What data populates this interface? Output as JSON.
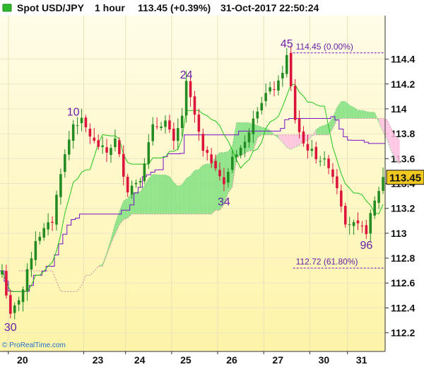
{
  "header": {
    "instrument": "Spot USD/JPY",
    "timeframe": "1 hour",
    "price": "113.45",
    "change": "(+0.39%)",
    "datetime": "31-Oct-2017 22:50:24"
  },
  "copyright": "© ProRealTime.com",
  "colors": {
    "background_top": "#fffce8",
    "background_bottom": "#fdf4a8",
    "bull_candle": "#228b22",
    "bear_candle": "#dc143c",
    "tenkan_sen": "#22c41c",
    "kijun_sen": "#7a10c8",
    "cloud_bearish": "#ffc0e0",
    "cloud_bullish": "#80e080",
    "wave_label": "#6a1fa8",
    "current_price_box": "#f0c820",
    "icon_green": "#2eb82e"
  },
  "icons": [
    "chart-panel-icon"
  ],
  "chart_data": {
    "type": "candlestick",
    "title": "Spot USD/JPY",
    "timeframe": "1 hour",
    "ylim": [
      112.05,
      114.75
    ],
    "y_ticks": [
      "112.2",
      "112.4",
      "112.6",
      "112.8",
      "113",
      "113.2",
      "113.4",
      "113.6",
      "113.8",
      "114",
      "114.2",
      "114.4"
    ],
    "x_ticks": [
      {
        "label": "20",
        "bar": 2
      },
      {
        "label": "23",
        "bar": 20
      },
      {
        "label": "24",
        "bar": 30
      },
      {
        "label": "25",
        "bar": 41
      },
      {
        "label": "26",
        "bar": 52
      },
      {
        "label": "27",
        "bar": 63
      },
      {
        "label": "30",
        "bar": 74
      },
      {
        "label": "31",
        "bar": 83
      }
    ],
    "current_price": "113.45",
    "grid": true,
    "level_lines": [
      {
        "label": "114.45 (0.00%)",
        "value": 114.45,
        "start_bar": 70
      },
      {
        "label": "112.72 (61.80%)",
        "value": 112.72,
        "start_bar": 70
      }
    ],
    "wave_labels": [
      {
        "text": "30",
        "bar": 2,
        "value": 112.34,
        "position": "below"
      },
      {
        "text": "10",
        "bar": 17,
        "value": 113.9,
        "position": "above"
      },
      {
        "text": "24",
        "bar": 44,
        "value": 114.2,
        "position": "above"
      },
      {
        "text": "34",
        "bar": 53,
        "value": 113.35,
        "position": "below"
      },
      {
        "text": "45",
        "bar": 68,
        "value": 114.45,
        "position": "above"
      },
      {
        "text": "96",
        "bar": 87,
        "value": 113.0,
        "position": "below"
      }
    ],
    "keypoints": [
      {
        "bar": 0,
        "value": 112.7
      },
      {
        "bar": 2,
        "value": 112.33
      },
      {
        "bar": 5,
        "value": 112.55
      },
      {
        "bar": 8,
        "value": 112.95
      },
      {
        "bar": 12,
        "value": 113.1
      },
      {
        "bar": 14,
        "value": 113.5
      },
      {
        "bar": 17,
        "value": 113.88
      },
      {
        "bar": 19,
        "value": 113.9
      },
      {
        "bar": 22,
        "value": 113.73
      },
      {
        "bar": 25,
        "value": 113.65
      },
      {
        "bar": 27,
        "value": 113.75
      },
      {
        "bar": 30,
        "value": 113.35
      },
      {
        "bar": 33,
        "value": 113.45
      },
      {
        "bar": 36,
        "value": 113.85
      },
      {
        "bar": 39,
        "value": 113.9
      },
      {
        "bar": 41,
        "value": 113.72
      },
      {
        "bar": 43,
        "value": 113.95
      },
      {
        "bar": 44,
        "value": 114.2
      },
      {
        "bar": 46,
        "value": 113.95
      },
      {
        "bar": 48,
        "value": 113.65
      },
      {
        "bar": 51,
        "value": 113.55
      },
      {
        "bar": 53,
        "value": 113.38
      },
      {
        "bar": 55,
        "value": 113.62
      },
      {
        "bar": 58,
        "value": 113.72
      },
      {
        "bar": 60,
        "value": 113.95
      },
      {
        "bar": 63,
        "value": 114.12
      },
      {
        "bar": 66,
        "value": 114.2
      },
      {
        "bar": 68,
        "value": 114.42
      },
      {
        "bar": 70,
        "value": 113.92
      },
      {
        "bar": 72,
        "value": 113.72
      },
      {
        "bar": 75,
        "value": 113.62
      },
      {
        "bar": 78,
        "value": 113.55
      },
      {
        "bar": 80,
        "value": 113.38
      },
      {
        "bar": 82,
        "value": 113.1
      },
      {
        "bar": 85,
        "value": 113.05
      },
      {
        "bar": 87,
        "value": 113.02
      },
      {
        "bar": 89,
        "value": 113.25
      },
      {
        "bar": 91,
        "value": 113.45
      }
    ]
  }
}
